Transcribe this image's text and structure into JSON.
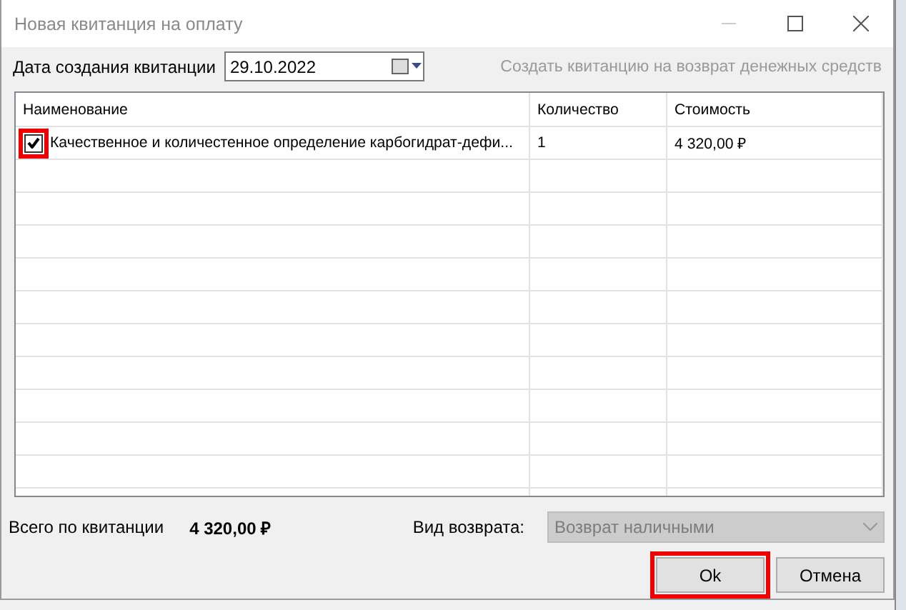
{
  "window": {
    "title": "Новая квитанция на оплату"
  },
  "date_field": {
    "label": "Дата создания квитанции",
    "value": "29.10.2022"
  },
  "refund_link": {
    "label": "Создать квитанцию на возврат денежных средств",
    "disabled": true
  },
  "table": {
    "columns": [
      "Наименование",
      "Количество",
      "Стоимость"
    ],
    "rows": [
      {
        "checked": true,
        "highlighted": true,
        "cells": [
          "Качественное и количестенное определение карбогидрат-дефи...",
          "1",
          "4 320,00 ₽"
        ]
      }
    ]
  },
  "total": {
    "label": "Всего по квитанции",
    "value": "4 320,00 ₽"
  },
  "refund_type": {
    "label": "Вид возврата:",
    "value": "Возврат наличными",
    "disabled": true
  },
  "buttons": [
    {
      "label": "Ok",
      "highlighted": true
    },
    {
      "label": "Отмена",
      "highlighted": false
    }
  ]
}
